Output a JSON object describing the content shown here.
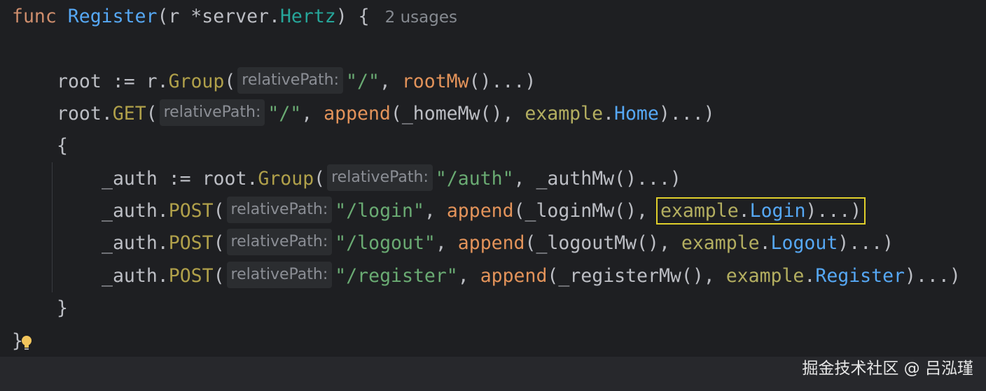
{
  "editor": {
    "lines": [
      {
        "func_kw": "func",
        "func_name": "Register",
        "params_open": "(r *",
        "param_pkg": "server",
        "dot": ".",
        "param_type": "Hertz",
        "params_close": ") {",
        "usages": "2 usages"
      },
      {},
      {
        "var": "root := r.",
        "method": "Group",
        "open": "(",
        "hint": "relativePath:",
        "str": "\"/\"",
        "rest1": ", ",
        "call": "rootMw",
        "rest2": "()...)"
      },
      {
        "var": "root.",
        "method": "GET",
        "open": "(",
        "hint": "relativePath:",
        "str": "\"/\"",
        "rest1": ", ",
        "call": "append",
        "rest2": "(_homeMw(), ",
        "pkg": "example",
        "dot": ".",
        "ref": "Home",
        "rest3": ")...)"
      },
      {
        "text": "{"
      },
      {
        "var": "_auth := root.",
        "method": "Group",
        "open": "(",
        "hint": "relativePath:",
        "str": "\"/auth\"",
        "rest1": ", _authMw()...)"
      },
      {
        "var": "_auth.",
        "method": "POST",
        "open": "(",
        "hint": "relativePath:",
        "str": "\"/login\"",
        "rest1": ", ",
        "call": "append",
        "rest2": "(_loginMw(),",
        "pkg": "example",
        "dot": ".",
        "ref": "Login",
        "rest3": ")...)"
      },
      {
        "var": "_auth.",
        "method": "POST",
        "open": "(",
        "hint": "relativePath:",
        "str": "\"/logout\"",
        "rest1": ", ",
        "call": "append",
        "rest2": "(_logoutMw(), ",
        "pkg": "example",
        "dot": ".",
        "ref": "Logout",
        "rest3": ")...)"
      },
      {
        "var": "_auth.",
        "method": "POST",
        "open": "(",
        "hint": "relativePath:",
        "str": "\"/register\"",
        "rest1": ", ",
        "call": "append",
        "rest2": "(_registerMw(), ",
        "pkg": "example",
        "dot": ".",
        "ref": "Register",
        "rest3": ")...)"
      },
      {
        "text": "}"
      },
      {
        "text": "}"
      }
    ]
  },
  "watermark": "掘金技术社区 @ 吕泓瑾",
  "icons": {
    "intention_bulb": "lightbulb-icon"
  },
  "colors": {
    "background": "#1e1f22",
    "keyword": "#cf8e6d",
    "string": "#6aab73",
    "function": "#56a8f5",
    "highlight_box": "#e0cf2b"
  }
}
